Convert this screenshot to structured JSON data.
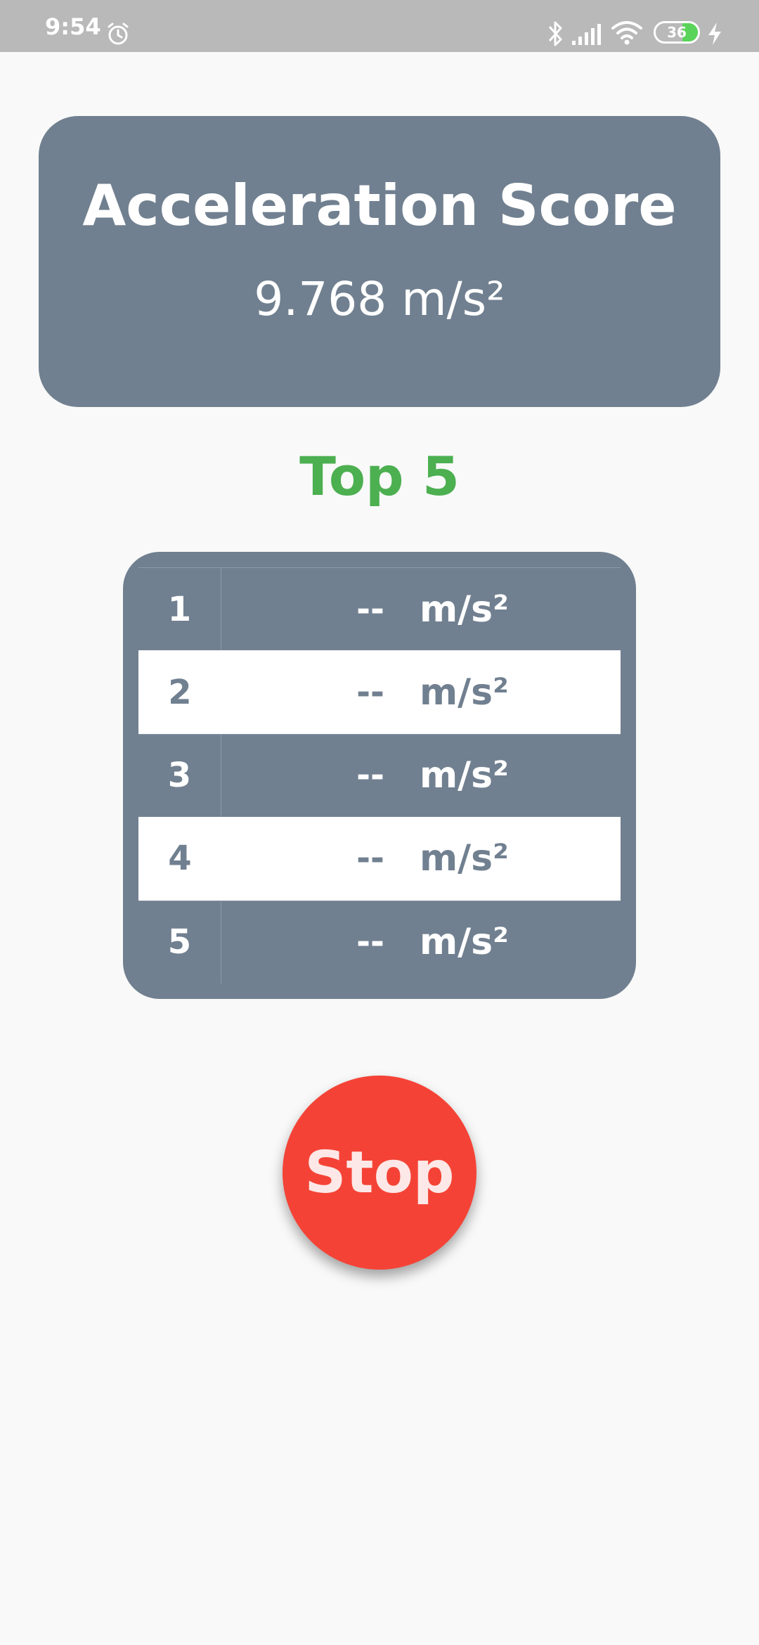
{
  "status_bar": {
    "time": "9:54",
    "battery_level": "36",
    "icons": [
      "alarm-icon",
      "bluetooth-icon",
      "signal-icon",
      "wifi-icon",
      "battery-icon",
      "charging-icon"
    ]
  },
  "score_card": {
    "title": "Acceleration Score",
    "value": "9.768 m/s²"
  },
  "top5": {
    "title": "Top 5",
    "rows": [
      {
        "rank": "1",
        "score": "--",
        "unit": "m/s²"
      },
      {
        "rank": "2",
        "score": "--",
        "unit": "m/s²"
      },
      {
        "rank": "3",
        "score": "--",
        "unit": "m/s²"
      },
      {
        "rank": "4",
        "score": "--",
        "unit": "m/s²"
      },
      {
        "rank": "5",
        "score": "--",
        "unit": "m/s²"
      }
    ]
  },
  "stop_button": {
    "label": "Stop"
  },
  "colors": {
    "card": "#718090",
    "accent_green": "#4caf50",
    "stop_red": "#f44336",
    "status_bar": "#b9b9b9",
    "background": "#f9f9f9"
  }
}
